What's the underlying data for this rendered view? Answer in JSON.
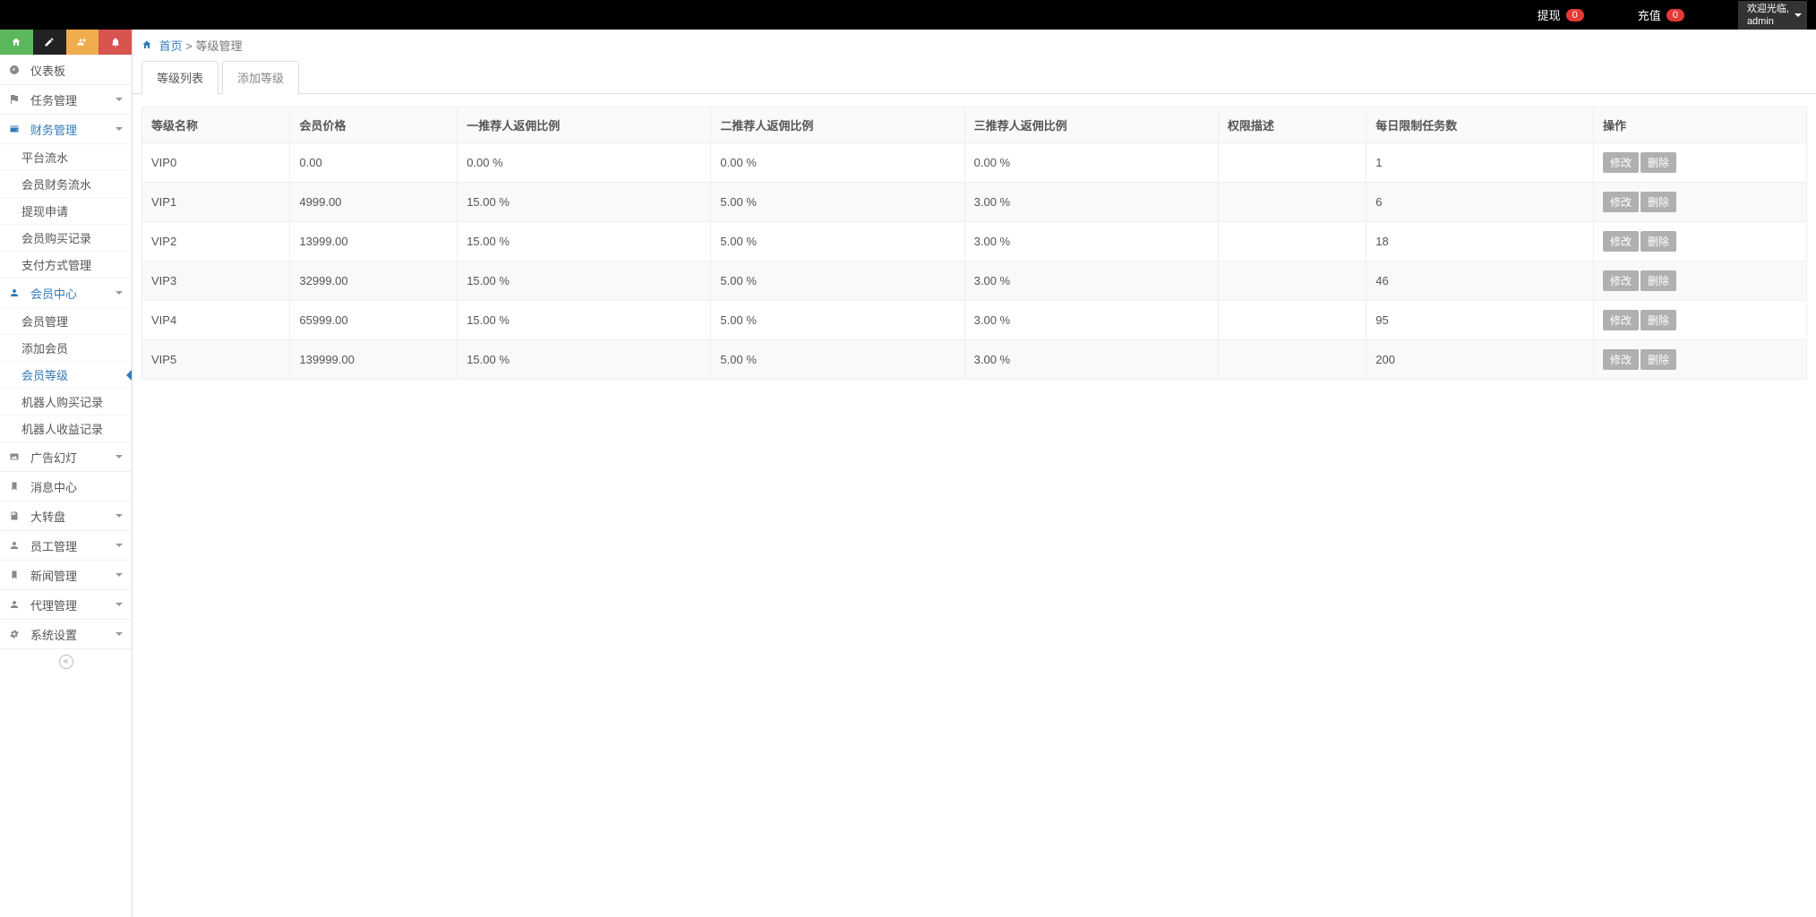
{
  "topbar": {
    "withdraw": {
      "label": "提现",
      "count": "0"
    },
    "recharge": {
      "label": "充值",
      "count": "0"
    },
    "welcome": "欢迎光临,",
    "username": "admin"
  },
  "breadcrumb": {
    "home": "首页",
    "sep": ">",
    "current": "等级管理"
  },
  "tabs": {
    "list": "等级列表",
    "add": "添加等级"
  },
  "sidebar": {
    "items": [
      {
        "icon": "dashboard",
        "label": "仪表板",
        "expandable": false
      },
      {
        "icon": "flag",
        "label": "任务管理",
        "expandable": true
      },
      {
        "icon": "wallet",
        "label": "财务管理",
        "expandable": true,
        "active": true,
        "children": [
          {
            "label": "平台流水"
          },
          {
            "label": "会员财务流水"
          },
          {
            "label": "提现申请"
          },
          {
            "label": "会员购买记录"
          },
          {
            "label": "支付方式管理"
          }
        ]
      },
      {
        "icon": "user",
        "label": "会员中心",
        "expandable": true,
        "active": true,
        "children": [
          {
            "label": "会员管理"
          },
          {
            "label": "添加会员"
          },
          {
            "label": "会员等级",
            "active": true
          },
          {
            "label": "机器人购买记录"
          },
          {
            "label": "机器人收益记录"
          }
        ]
      },
      {
        "icon": "image",
        "label": "广告幻灯",
        "expandable": true
      },
      {
        "icon": "bookmark",
        "label": "消息中心",
        "expandable": false
      },
      {
        "icon": "disk",
        "label": "大转盘",
        "expandable": true
      },
      {
        "icon": "user",
        "label": "员工管理",
        "expandable": true
      },
      {
        "icon": "bookmark",
        "label": "新闻管理",
        "expandable": true
      },
      {
        "icon": "user",
        "label": "代理管理",
        "expandable": true
      },
      {
        "icon": "gear",
        "label": "系统设置",
        "expandable": true
      }
    ]
  },
  "table": {
    "headers": [
      "等级名称",
      "会员价格",
      "一推荐人返佣比例",
      "二推荐人返佣比例",
      "三推荐人返佣比例",
      "权限描述",
      "每日限制任务数",
      "操作"
    ],
    "rows": [
      {
        "name": "VIP0",
        "price": "0.00",
        "r1": "0.00 %",
        "r2": "0.00 %",
        "r3": "0.00 %",
        "perm": "",
        "limit": "1"
      },
      {
        "name": "VIP1",
        "price": "4999.00",
        "r1": "15.00 %",
        "r2": "5.00 %",
        "r3": "3.00 %",
        "perm": "",
        "limit": "6"
      },
      {
        "name": "VIP2",
        "price": "13999.00",
        "r1": "15.00 %",
        "r2": "5.00 %",
        "r3": "3.00 %",
        "perm": "",
        "limit": "18"
      },
      {
        "name": "VIP3",
        "price": "32999.00",
        "r1": "15.00 %",
        "r2": "5.00 %",
        "r3": "3.00 %",
        "perm": "",
        "limit": "46"
      },
      {
        "name": "VIP4",
        "price": "65999.00",
        "r1": "15.00 %",
        "r2": "5.00 %",
        "r3": "3.00 %",
        "perm": "",
        "limit": "95"
      },
      {
        "name": "VIP5",
        "price": "139999.00",
        "r1": "15.00 %",
        "r2": "5.00 %",
        "r3": "3.00 %",
        "perm": "",
        "limit": "200"
      }
    ],
    "actions": {
      "edit": "修改",
      "delete": "删除"
    }
  }
}
